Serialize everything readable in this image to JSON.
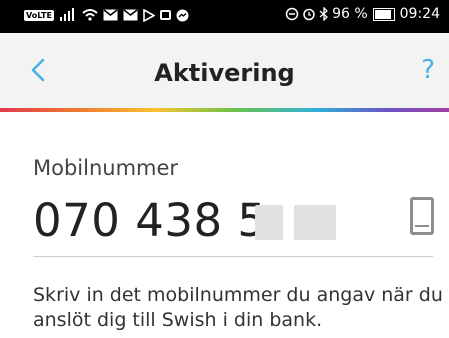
{
  "status_bar": {
    "icons_left": [
      "volte-icon",
      "signal-icon",
      "wifi-icon",
      "mail-icon",
      "mail-icon",
      "play-store-icon",
      "gallery-icon",
      "messenger-icon"
    ],
    "volte": "VoLTE",
    "battery_percent": "96 %",
    "time": "09:24"
  },
  "header": {
    "back_icon": "chevron-left-icon",
    "title": "Aktivering",
    "help": "?"
  },
  "colors": {
    "accent": "#46b1e1",
    "rainbow": [
      "#e03a4f",
      "#f07c2f",
      "#f5c431",
      "#6cc24a",
      "#2fb2d8",
      "#6b54c6",
      "#a33fa1"
    ]
  },
  "form": {
    "label": "Mobilnummer",
    "value": "070 438 5",
    "phone_icon": "phone-icon"
  },
  "description": "Skriv in det mobilnummer du angav när du anslöt dig till Swish i din bank."
}
